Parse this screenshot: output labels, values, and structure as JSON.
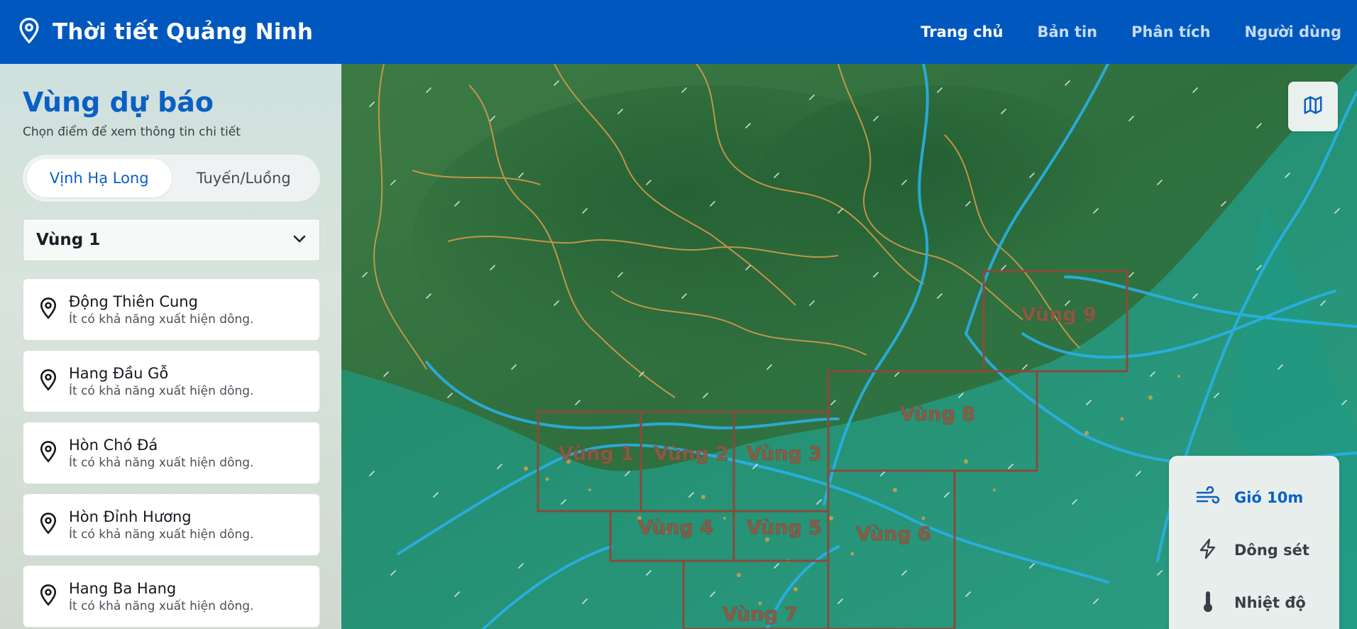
{
  "header": {
    "title": "Thời tiết Quảng Ninh",
    "nav": [
      "Trang chủ",
      "Bản tin",
      "Phân tích",
      "Người dùng"
    ]
  },
  "sidebar": {
    "title": "Vùng dự báo",
    "subtitle": "Chọn điểm để xem thông tin chi tiết",
    "tabs": [
      "Vịnh Hạ Long",
      "Tuyến/Luồng"
    ],
    "active_tab": "Vịnh Hạ Long",
    "selected_zone": "Vùng 1",
    "locations": [
      {
        "name": "Động Thiên Cung",
        "desc": "Ít có khả năng xuất hiện dông."
      },
      {
        "name": "Hang Đầu Gỗ",
        "desc": "Ít có khả năng xuất hiện dông."
      },
      {
        "name": "Hòn Chó Đá",
        "desc": "Ít có khả năng xuất hiện dông."
      },
      {
        "name": "Hòn Đỉnh Hương",
        "desc": "Ít có khả năng xuất hiện dông."
      },
      {
        "name": "Hang Ba Hang",
        "desc": "Ít có khả năng xuất hiện dông."
      }
    ]
  },
  "map": {
    "zones": [
      "Vùng 1",
      "Vùng 2",
      "Vùng 3",
      "Vùng 4",
      "Vùng 5",
      "Vùng 6",
      "Vùng 7",
      "Vùng 8",
      "Vùng 9"
    ],
    "layers": [
      {
        "label": "Gió 10m",
        "icon": "wind-icon",
        "active": true
      },
      {
        "label": "Dông sét",
        "icon": "lightning-icon",
        "active": false
      },
      {
        "label": "Nhiệt độ",
        "icon": "thermometer-icon",
        "active": false
      }
    ]
  },
  "colors": {
    "header": "#0058bf",
    "accent": "#0a60c4",
    "zone_border": "#8a4a3a",
    "river": "#2ab0e6",
    "admin_border": "#d29a4a"
  }
}
